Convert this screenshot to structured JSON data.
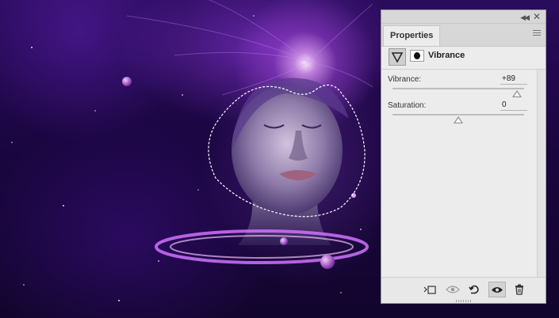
{
  "panel": {
    "tab_label": "Properties",
    "adjustment_title": "Vibrance",
    "icons": {
      "collapse": "double-chevron-left-icon",
      "close": "close-icon",
      "panel_menu": "hamburger-menu-icon",
      "adjustment": "vibrance-triangle-icon",
      "mask": "layer-mask-icon"
    },
    "sliders": [
      {
        "label": "Vibrance:",
        "value": "+89",
        "numeric": 89,
        "min": -100,
        "max": 100
      },
      {
        "label": "Saturation:",
        "value": "0",
        "numeric": 0,
        "min": -100,
        "max": 100
      }
    ],
    "bottom_tools": [
      {
        "name": "clip-to-layer-icon"
      },
      {
        "name": "view-previous-state-icon"
      },
      {
        "name": "reset-icon"
      },
      {
        "name": "toggle-visibility-eye-icon"
      },
      {
        "name": "trash-icon"
      }
    ]
  },
  "colors": {
    "panel_bg": "#ececec",
    "canvas_deep": "#14052e",
    "nebula_purple": "#7a2fd0",
    "glow": "#f3c7ff"
  }
}
